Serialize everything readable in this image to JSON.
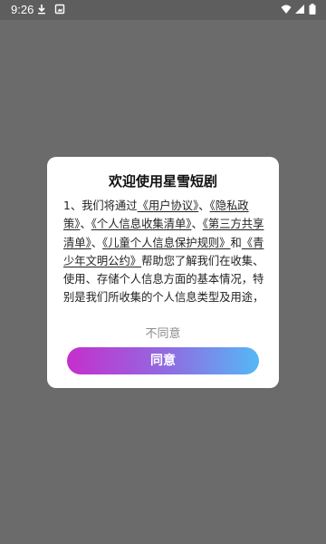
{
  "status_bar": {
    "time": "9:26",
    "icons": [
      "download-icon",
      "app-notification-icon",
      "wifi-icon",
      "cellular-icon",
      "battery-icon"
    ]
  },
  "dialog": {
    "title": "欢迎使用星雪短剧",
    "body": {
      "prefix": "1、我们将通过",
      "link_user_agreement": "《用户协议》",
      "sep1": "、",
      "link_privacy": "《隐私政策》",
      "sep2": "、",
      "link_collection_list": "《个人信息收集清单》",
      "sep3": "、",
      "link_third_party": "《第三方共享清单》",
      "sep4": "、",
      "link_children": "《儿童个人信息保护规则》",
      "and": "和",
      "link_youth": "《青少年文明公约》",
      "rest": "帮助您了解我们在收集、使用、存储个人信息方面的基本情况，特别是我们所收集的个人信息类型及用途，以"
    },
    "disagree_label": "不同意",
    "agree_label": "同意"
  },
  "colors": {
    "overlay": "#6b6b6b",
    "agree_gradient_start": "#c52fcd",
    "agree_gradient_end": "#55b8f5"
  }
}
